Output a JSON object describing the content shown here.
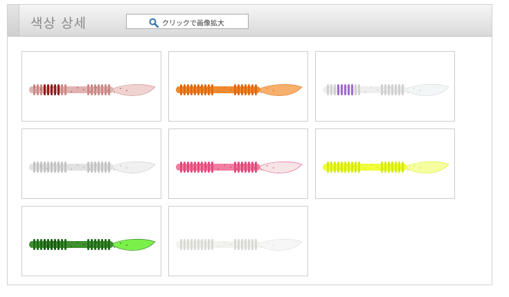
{
  "header": {
    "title": "색상 상세",
    "zoom_label": "クリックで画像拡大"
  },
  "items": [
    {
      "body": "#e0b3b0",
      "rib": "#c98a87",
      "accent": "#8e1d1d",
      "tail": "#efd3d0",
      "speck": "#a33a3a"
    },
    {
      "body": "#f08a2e",
      "rib": "#e06a12",
      "accent": "#e06a12",
      "tail": "#f7b06b",
      "speck": "#d45a00"
    },
    {
      "body": "#eeeeee",
      "rib": "#d0d0d0",
      "accent": "#a06ad0",
      "tail": "#f3f6f6",
      "speck": "#bbbbbb"
    },
    {
      "body": "#e2e2e2",
      "rib": "#c4c4c4",
      "accent": "#c4c4c4",
      "tail": "#f0f0f0",
      "speck": "#a8a8a8"
    },
    {
      "body": "#f27ea2",
      "rib": "#e04c7e",
      "accent": "#e84c80",
      "tail": "#f6e4e6",
      "speck": "#c0392b"
    },
    {
      "body": "#f0ff3a",
      "rib": "#d6ea10",
      "accent": "#d6ea10",
      "tail": "#f6ffa0",
      "speck": "#c7d800"
    },
    {
      "body": "#3f8f2e",
      "rib": "#1f6b1a",
      "accent": "#1a5a16",
      "tail": "#7cf04a",
      "speck": "#0f4a0f"
    },
    {
      "body": "#f2f2ee",
      "rib": "#dadad4",
      "accent": "#dadad4",
      "tail": "#f7f7f7",
      "speck": "#d0d0d0"
    }
  ]
}
